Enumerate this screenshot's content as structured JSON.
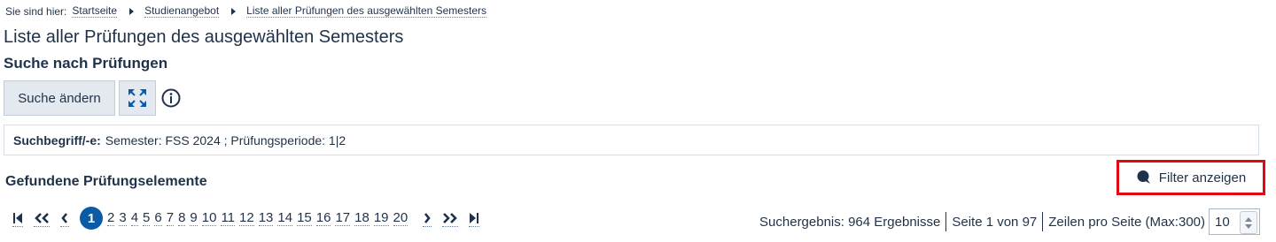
{
  "breadcrumb": {
    "prefix": "Sie sind hier:",
    "items": [
      "Startseite",
      "Studienangebot",
      "Liste aller Prüfungen des ausgewählten Semesters"
    ]
  },
  "page_title": "Liste aller Prüfungen des ausgewählten Semesters",
  "search_section": {
    "title": "Suche nach Prüfungen",
    "change_button": "Suche ändern",
    "expand_icon": "expand-icon",
    "info_icon": "info-icon"
  },
  "criteria": {
    "label": "Suchbegriff/-e:",
    "value": "Semester: FSS 2024 ;  Prüfungsperiode: 1|2"
  },
  "results": {
    "title": "Gefundene Prüfungselemente",
    "filter_button": "Filter anzeigen"
  },
  "pagination": {
    "current": "1",
    "pages": [
      "2",
      "3",
      "4",
      "5",
      "6",
      "7",
      "8",
      "9",
      "10",
      "11",
      "12",
      "13",
      "14",
      "15",
      "16",
      "17",
      "18",
      "19",
      "20"
    ]
  },
  "stats": {
    "result_count": "Suchergebnis: 964 Ergebnisse",
    "page_info": "Seite 1 von 97",
    "rows_label": "Zeilen pro Seite (Max:300)",
    "rows_value": "10"
  },
  "colors": {
    "text": "#1f3249",
    "current_page": "#0a5aa6",
    "highlight_border": "#e30613"
  }
}
